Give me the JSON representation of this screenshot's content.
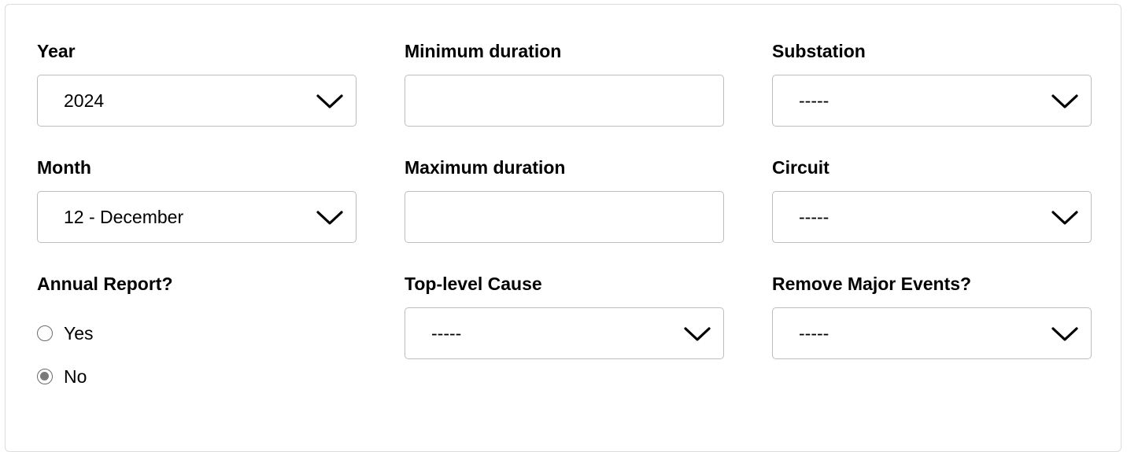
{
  "filters": {
    "year": {
      "label": "Year",
      "value": "2024"
    },
    "month": {
      "label": "Month",
      "value": "12 - December"
    },
    "annual_report": {
      "label": "Annual Report?",
      "options": [
        "Yes",
        "No"
      ],
      "selected": "No"
    },
    "min_duration": {
      "label": "Minimum duration",
      "value": ""
    },
    "max_duration": {
      "label": "Maximum duration",
      "value": ""
    },
    "top_level_cause": {
      "label": "Top-level Cause",
      "value": "-----"
    },
    "substation": {
      "label": "Substation",
      "value": "-----"
    },
    "circuit": {
      "label": "Circuit",
      "value": "-----"
    },
    "remove_major_events": {
      "label": "Remove Major Events?",
      "value": "-----"
    }
  },
  "icons": {
    "dropdown": "chevron-down-icon",
    "radio_empty": "radio-unchecked-icon",
    "radio_filled": "radio-checked-icon"
  },
  "colors": {
    "border": "#bdbdbd",
    "card_border": "#dcdcdc",
    "radio_fill": "#7a7a7a",
    "text": "#000000"
  }
}
